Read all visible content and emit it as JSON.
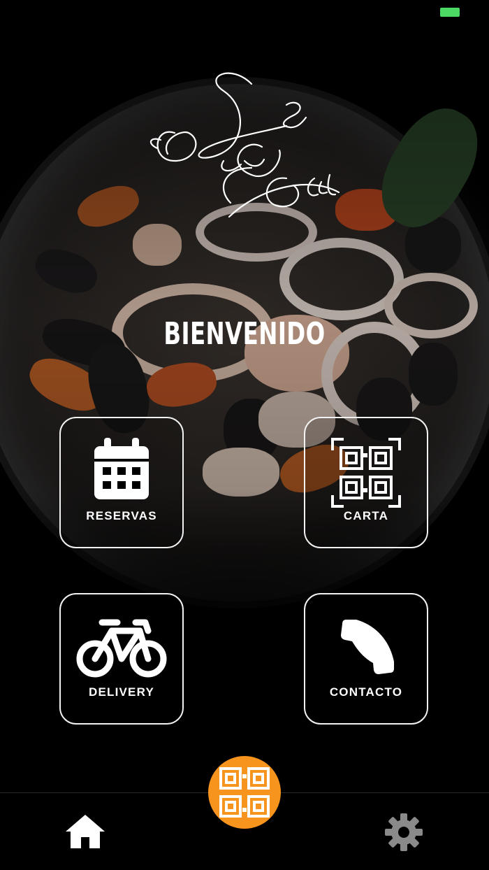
{
  "app": {
    "logo_alt": "Le Due Torri",
    "logo_lines": [
      "Le",
      "Due",
      "Torri"
    ],
    "welcome": "BIENVENIDO"
  },
  "tiles": [
    {
      "label": "RESERVAS",
      "icon": "calendar-icon"
    },
    {
      "label": "CARTA",
      "icon": "qr-code-icon"
    },
    {
      "label": "DELIVERY",
      "icon": "bicycle-icon"
    },
    {
      "label": "CONTACTO",
      "icon": "phone-icon"
    }
  ],
  "tabbar": {
    "home_icon": "home-icon",
    "scan_icon": "qr-scan-icon",
    "settings_icon": "gear-icon"
  },
  "colors": {
    "accent": "#f7941d",
    "battery": "#4cd964",
    "background": "#000000",
    "foreground": "#ffffff"
  }
}
